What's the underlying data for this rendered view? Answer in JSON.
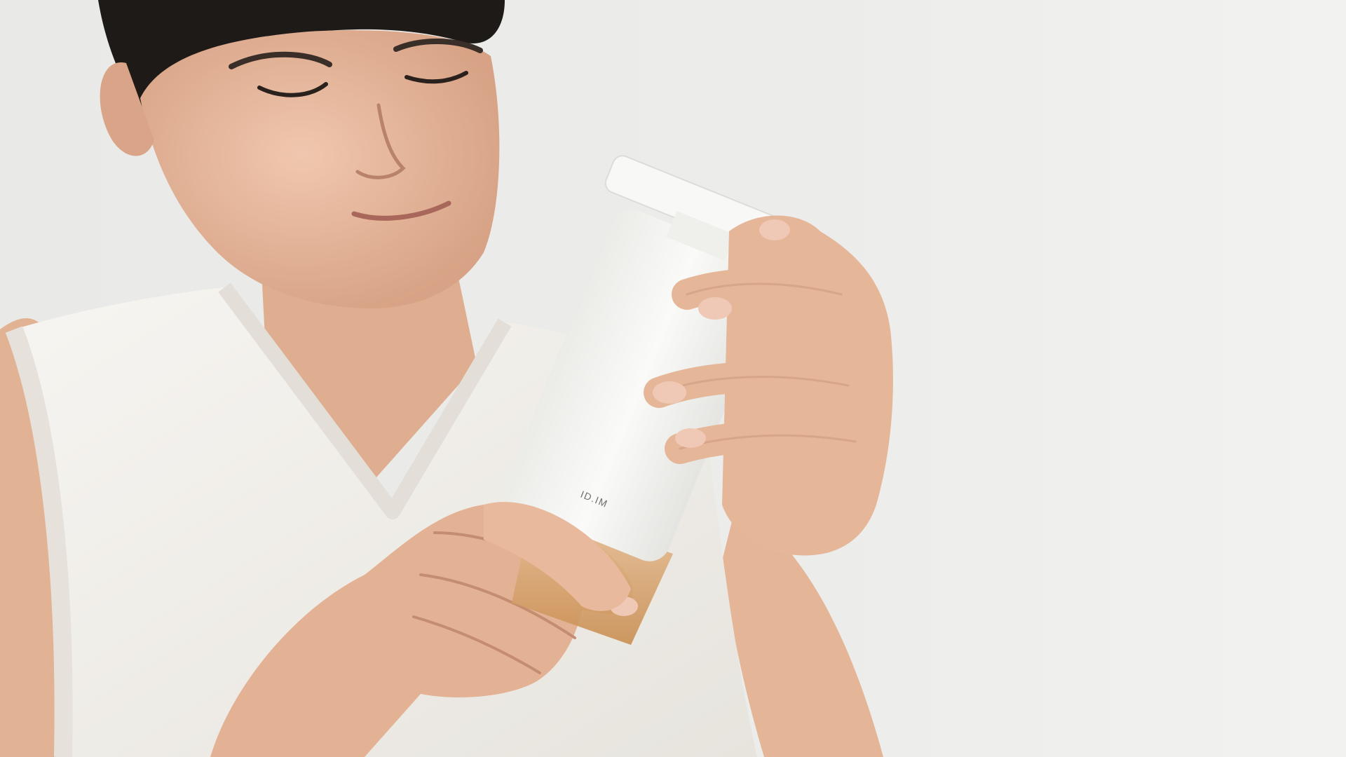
{
  "photo": {
    "product_label": "ID.IM",
    "colors": {
      "wall": "#e8e8e6",
      "wall_light": "#f3f3f1",
      "skin": "#e6b89d",
      "skin_shade": "#cf9a7c",
      "hair": "#1d1a18",
      "vest": "#f4f2ee",
      "product": "#f6f6f4",
      "soap": "#d9a46a"
    }
  }
}
